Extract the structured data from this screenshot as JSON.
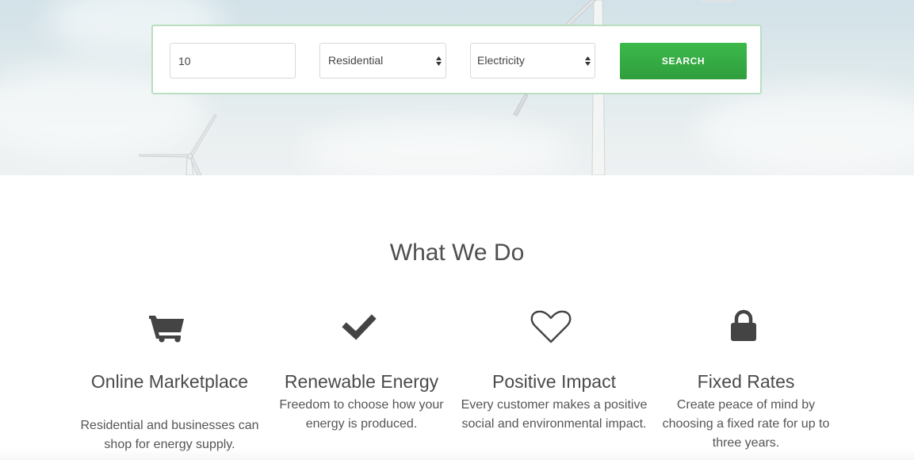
{
  "search": {
    "zip_value": "10",
    "customer_type_selected": "Residential",
    "utility_selected": "Electricity",
    "button_label": "SEARCH",
    "accent_color": "#37ae45"
  },
  "section": {
    "title": "What We Do",
    "features": [
      {
        "icon": "shopping-cart-icon",
        "title": "Online Marketplace",
        "description": "Residential and businesses can shop for energy supply."
      },
      {
        "icon": "checkmark-icon",
        "title": "Renewable Energy",
        "description": "Freedom to choose how your energy is produced."
      },
      {
        "icon": "heart-icon",
        "title": "Positive Impact",
        "description": "Every customer makes a positive social and environmental impact."
      },
      {
        "icon": "lock-icon",
        "title": "Fixed Rates",
        "description": "Create peace of mind by choosing a fixed rate for up to three years."
      }
    ]
  }
}
